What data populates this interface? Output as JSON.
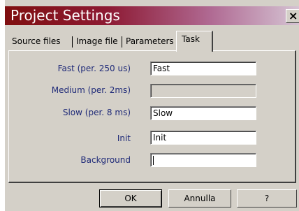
{
  "window": {
    "title": "Project Settings",
    "close_glyph": "×",
    "titlebar_colors": [
      "#7f0f10",
      "#d5c3d3"
    ]
  },
  "tabs": [
    {
      "label": "Source files",
      "active": false
    },
    {
      "label": "Image file",
      "active": false
    },
    {
      "label": "Parameters",
      "active": false
    },
    {
      "label": "Task",
      "active": true
    }
  ],
  "fields": [
    {
      "label": "Fast (per. 250 us)",
      "value": "Fast",
      "enabled": true
    },
    {
      "label": "Medium (per. 2ms)",
      "value": "",
      "enabled": false
    },
    {
      "label": "Slow (per. 8 ms)",
      "value": "Slow",
      "enabled": true
    },
    {
      "label": "Init",
      "value": "Init",
      "enabled": true
    },
    {
      "label": "Background",
      "value": "",
      "enabled": true,
      "focused": true
    }
  ],
  "buttons": {
    "ok": "OK",
    "cancel": "Annulla",
    "help": "?"
  },
  "colors": {
    "label_text": "#1f2a78",
    "dialog_face": "#d4d0c8"
  }
}
